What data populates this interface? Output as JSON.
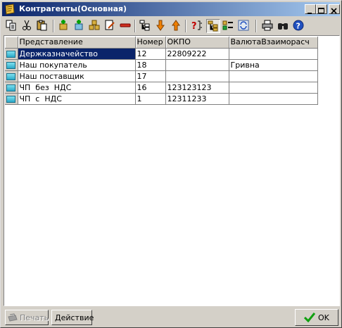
{
  "window": {
    "title": "Контрагенты(Основная)"
  },
  "toolbar": {
    "icons": [
      "copy-icon",
      "cut-icon",
      "paste-icon",
      "add-icon",
      "add-group-icon",
      "move-to-group-icon",
      "edit-icon",
      "delete-icon",
      "tree-view-icon",
      "move-down-icon",
      "move-up-icon",
      "filter-icon",
      "hierarchy-icon",
      "list-icon",
      "refresh-icon",
      "print-icon",
      "find-icon",
      "help-icon"
    ]
  },
  "table": {
    "columns": [
      "Представление",
      "Номер",
      "ОКПО",
      "ВалютаВзаиморасч"
    ],
    "rows": [
      {
        "name": "Держказначейство",
        "number": "12",
        "okpo": "22809222",
        "currency": ""
      },
      {
        "name": "Наш покупатель",
        "number": "18",
        "okpo": "",
        "currency": "Гривна"
      },
      {
        "name": "Наш поставщик",
        "number": "17",
        "okpo": "",
        "currency": ""
      },
      {
        "name": "ЧП  без  НДС",
        "number": "16",
        "okpo": "123123123",
        "currency": ""
      },
      {
        "name": "ЧП  с  НДС",
        "number": "1",
        "okpo": "12311233",
        "currency": ""
      }
    ]
  },
  "buttons": {
    "print": "Печать",
    "action": "Действие",
    "ok": "OK"
  }
}
